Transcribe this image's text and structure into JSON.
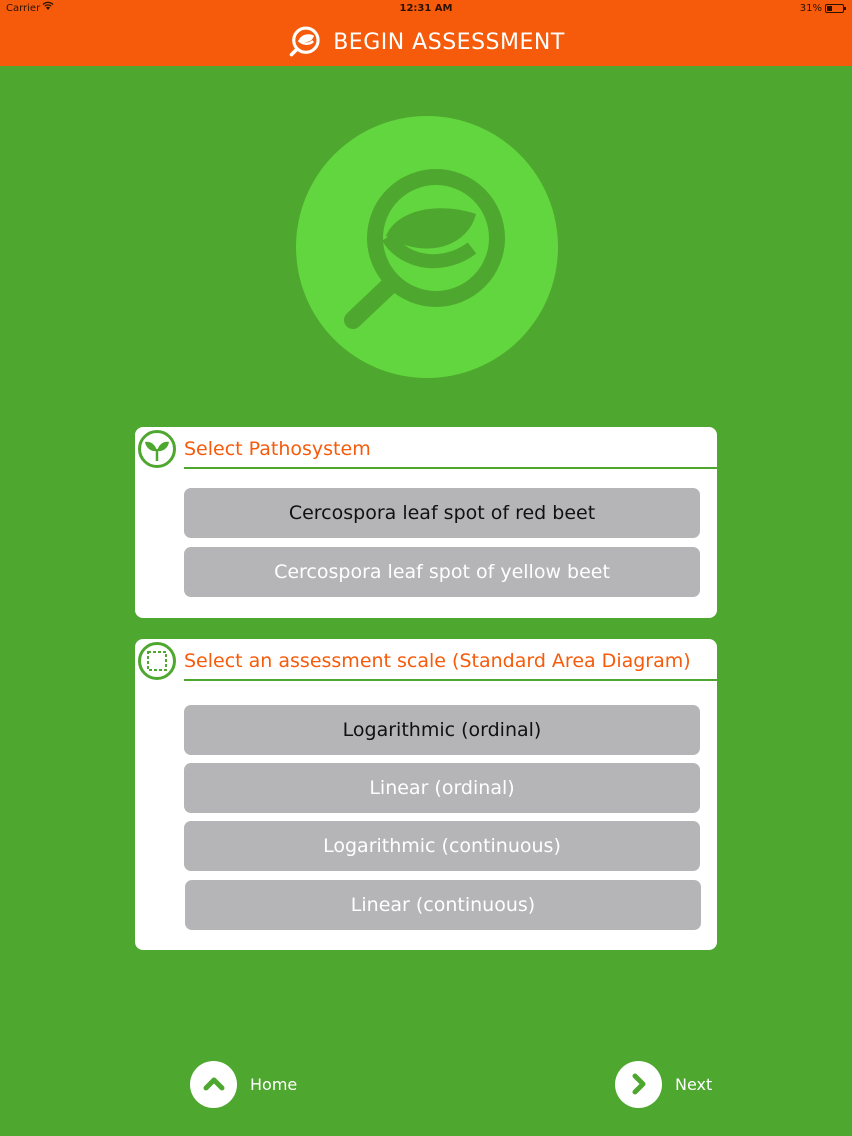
{
  "status_bar": {
    "carrier": "Carrier",
    "time": "12:31 AM",
    "battery": "31%"
  },
  "header": {
    "title": "BEGIN ASSESSMENT",
    "icon": "leaf-magnifier-icon"
  },
  "colors": {
    "header_orange": "#f65b0b",
    "background_green": "#4ea72e",
    "logo_green": "#62d63e",
    "button_gray": "#b5b4b6"
  },
  "pathosystem": {
    "title": "Select Pathosystem",
    "icon": "plant-icon",
    "options": [
      {
        "label": "Cercospora leaf spot of red beet",
        "selected": true
      },
      {
        "label": "Cercospora leaf spot of yellow beet",
        "selected": false
      }
    ]
  },
  "scale": {
    "title": "Select an assessment scale (Standard Area Diagram)",
    "icon": "dashed-square-icon",
    "options": [
      {
        "label": "Logarithmic (ordinal)",
        "selected": true
      },
      {
        "label": "Linear (ordinal)",
        "selected": false
      },
      {
        "label": "Logarithmic (continuous)",
        "selected": false
      },
      {
        "label": "Linear (continuous)",
        "selected": false
      }
    ]
  },
  "nav": {
    "home_label": "Home",
    "next_label": "Next"
  }
}
